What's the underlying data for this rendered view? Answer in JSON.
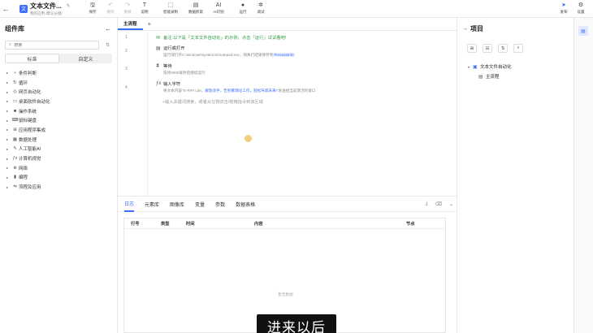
{
  "header": {
    "logo_char": "文",
    "title": "文本文件...",
    "subtitle": "我的应用 /默认分组/",
    "buttons": [
      {
        "label": "保存",
        "icon": "🖫",
        "disabled": false
      },
      {
        "label": "撤销",
        "icon": "↶",
        "disabled": true
      },
      {
        "label": "重做",
        "icon": "↷",
        "disabled": true
      },
      {
        "label": "说明",
        "icon": "T",
        "disabled": false
      },
      {
        "label": "智能录制",
        "icon": "⬚",
        "disabled": false
      },
      {
        "label": "数据抓取",
        "icon": "▤",
        "disabled": false
      },
      {
        "label": "AI识别",
        "icon": "AI",
        "disabled": false
      },
      {
        "label": "运行",
        "icon": "●",
        "disabled": false
      },
      {
        "label": "调试",
        "icon": "✲",
        "disabled": false
      },
      {
        "label": "发布",
        "icon": "➤",
        "disabled": false
      },
      {
        "label": "设置",
        "icon": "⚙",
        "disabled": false
      }
    ]
  },
  "left_panel": {
    "title": "组件库",
    "search_placeholder": "搜索",
    "tabs": [
      "标准",
      "自定义"
    ],
    "active_tab": 0,
    "items": [
      {
        "label": "条件判断",
        "icon": "⑂"
      },
      {
        "label": "循环",
        "icon": "↻"
      },
      {
        "label": "网页自动化",
        "icon": "◎"
      },
      {
        "label": "桌面软件自动化",
        "icon": "▭"
      },
      {
        "label": "操作系统",
        "icon": "■"
      },
      {
        "label": "鼠标键盘",
        "icon": "⌨"
      },
      {
        "label": "应用程序集成",
        "icon": "⊞"
      },
      {
        "label": "数据处理",
        "icon": "▦"
      },
      {
        "label": "人工智能AI",
        "icon": "✎"
      },
      {
        "label": "计算机视觉",
        "icon": "ƒx"
      },
      {
        "label": "网络",
        "icon": "⊕"
      },
      {
        "label": "编程",
        "icon": "▮"
      },
      {
        "label": "流程及应用",
        "icon": "⇋"
      }
    ]
  },
  "center": {
    "tab_label": "主流程",
    "line_numbers": [
      "1",
      "2",
      "3",
      "4"
    ],
    "comment": {
      "prefix": "备注:以下是",
      "highlight": "「文本文件自动化」",
      "mid": "的示例，点击",
      "highlight2": "「运行」",
      "suffix": "试试看吧!"
    },
    "steps": [
      {
        "icon": "▤",
        "title": "运行或打开",
        "desc_prefix": "运行或打开C:\\windows\\system32\\notepad.exe，将执行结果保存到",
        "desc_tag": "ProcessInfo",
        "desc_suffix": ""
      },
      {
        "icon": "⧗",
        "title": "等待",
        "desc_prefix": "等待2000毫秒后继续运行",
        "desc_tag": "",
        "desc_suffix": ""
      },
      {
        "icon": "ƒx",
        "title": "输入字符",
        "desc_prefix": "将文本内容\"K-RPA Lite，",
        "desc_tag": "解放双手，告别繁琐化工作，轻松驾驭未来!",
        "desc_suffix": "\"发送给当前激活的窗口"
      }
    ],
    "hint": "+输入关键词搜索，或者从左侧双击/拖拽指令到该区域"
  },
  "bottom": {
    "tabs": [
      "日志",
      "元素库",
      "图像库",
      "变量",
      "参数",
      "数据表格"
    ],
    "active_tab": 0,
    "icons": [
      "⤓",
      "⌫",
      "⌄"
    ],
    "columns": [
      "行号",
      "类型",
      "时间",
      "内容",
      "节点"
    ],
    "empty_text": "暂无数据",
    "caption": "进来以后"
  },
  "right_panel": {
    "title": "项目",
    "icons": [
      "⊞",
      "⊟",
      "⇅",
      "⌕"
    ],
    "tree": {
      "root": "文本文件自动化",
      "child": "主流程"
    }
  },
  "colors": {
    "accent": "#3b6ef5",
    "comment": "#2e9a40"
  }
}
